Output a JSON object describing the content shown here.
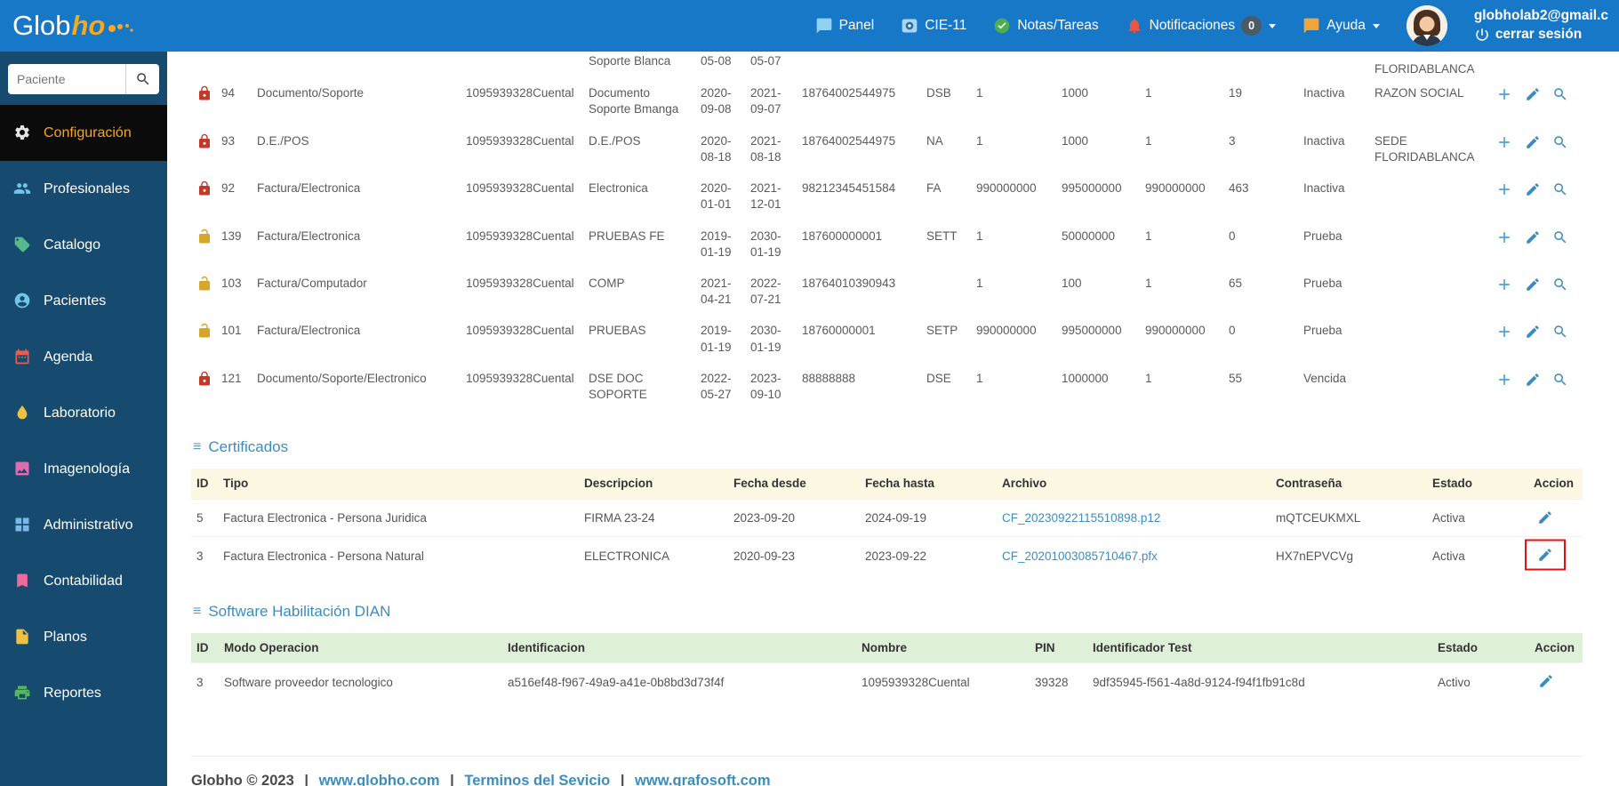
{
  "colors": {
    "navbar_blue": "#1878c8",
    "sidebar_navy": "#164a6e",
    "active_item_bg": "#0b0b0b",
    "active_item_text": "#f5a623",
    "link_blue": "#3c8dbc",
    "cert_header_bg": "#fcf8e3",
    "dian_header_bg": "#dff0d8",
    "annotation_red": "#e8100c",
    "lock_red": "#c0392b",
    "lock_gold": "#d4a72c"
  },
  "navbar": {
    "brand_glob": "Glob",
    "brand_ho": "ho",
    "items": [
      {
        "label": "Panel",
        "icon": "chat-icon"
      },
      {
        "label": "CIE-11",
        "icon": "cie11-icon"
      },
      {
        "label": "Notas/Tareas",
        "icon": "check-circle-icon"
      },
      {
        "label": "Notificaciones",
        "icon": "bell-icon",
        "badge": "0"
      },
      {
        "label": "Ayuda",
        "icon": "help-chat-icon"
      }
    ],
    "user_email": "globholab2@gmail.c",
    "logout_label": "cerrar sesión"
  },
  "sidebar": {
    "search_placeholder": "Paciente",
    "items": [
      {
        "label": "Configuración",
        "icon": "gear-icon",
        "active": true
      },
      {
        "label": "Profesionales",
        "icon": "people-icon"
      },
      {
        "label": "Catalogo",
        "icon": "tag-icon"
      },
      {
        "label": "Pacientes",
        "icon": "person-icon"
      },
      {
        "label": "Agenda",
        "icon": "calendar-icon"
      },
      {
        "label": "Laboratorio",
        "icon": "droplet-icon"
      },
      {
        "label": "Imagenología",
        "icon": "image-icon"
      },
      {
        "label": "Administrativo",
        "icon": "grid-icon"
      },
      {
        "label": "Contabilidad",
        "icon": "bookmark-icon"
      },
      {
        "label": "Planos",
        "icon": "file-icon"
      },
      {
        "label": "Reportes",
        "icon": "printer-icon"
      }
    ]
  },
  "resolutions": {
    "partial_row": {
      "desc": "Soporte Blanca",
      "fecha_desde": "05-08",
      "fecha_hasta": "05-07",
      "sede": "FLORIDABLANCA"
    },
    "rows": [
      {
        "lock": "closed-red",
        "id": "94",
        "tipo": "Documento/Soporte",
        "cuenta": "1095939328Cuental",
        "desc": "Documento Soporte Bmanga",
        "fd1": "2020-",
        "fd2": "09-08",
        "fh1": "2021-",
        "fh2": "09-07",
        "resolucion": "18764002544975",
        "prefijo": "DSB",
        "n1": "1",
        "n2": "1000",
        "n3": "1",
        "n4": "19",
        "estado": "Inactiva",
        "sede": "RAZON SOCIAL"
      },
      {
        "lock": "closed-red",
        "id": "93",
        "tipo": "D.E./POS",
        "cuenta": "1095939328Cuental",
        "desc": "D.E./POS",
        "fd1": "2020-",
        "fd2": "08-18",
        "fh1": "2021-",
        "fh2": "08-18",
        "resolucion": "18764002544975",
        "prefijo": "NA",
        "n1": "1",
        "n2": "1000",
        "n3": "1",
        "n4": "3",
        "estado": "Inactiva",
        "sede": "SEDE FLORIDABLANCA"
      },
      {
        "lock": "closed-red",
        "id": "92",
        "tipo": "Factura/Electronica",
        "cuenta": "1095939328Cuental",
        "desc": "Electronica",
        "fd1": "2020-",
        "fd2": "01-01",
        "fh1": "2021-",
        "fh2": "12-01",
        "resolucion": "98212345451584",
        "prefijo": "FA",
        "n1": "990000000",
        "n2": "995000000",
        "n3": "990000000",
        "n4": "463",
        "estado": "Inactiva",
        "sede": ""
      },
      {
        "lock": "open-gold",
        "id": "139",
        "tipo": "Factura/Electronica",
        "cuenta": "1095939328Cuental",
        "desc": "PRUEBAS FE",
        "fd1": "2019-",
        "fd2": "01-19",
        "fh1": "2030-",
        "fh2": "01-19",
        "resolucion": "187600000001",
        "prefijo": "SETT",
        "n1": "1",
        "n2": "50000000",
        "n3": "1",
        "n4": "0",
        "estado": "Prueba",
        "sede": ""
      },
      {
        "lock": "open-gold",
        "id": "103",
        "tipo": "Factura/Computador",
        "cuenta": "1095939328Cuental",
        "desc": "COMP",
        "fd1": "2021-",
        "fd2": "04-21",
        "fh1": "2022-",
        "fh2": "07-21",
        "resolucion": "18764010390943",
        "prefijo": "",
        "n1": "1",
        "n2": "100",
        "n3": "1",
        "n4": "65",
        "estado": "Prueba",
        "sede": ""
      },
      {
        "lock": "open-gold",
        "id": "101",
        "tipo": "Factura/Electronica",
        "cuenta": "1095939328Cuental",
        "desc": "PRUEBAS",
        "fd1": "2019-",
        "fd2": "01-19",
        "fh1": "2030-",
        "fh2": "01-19",
        "resolucion": "18760000001",
        "prefijo": "SETP",
        "n1": "990000000",
        "n2": "995000000",
        "n3": "990000000",
        "n4": "0",
        "estado": "Prueba",
        "sede": ""
      },
      {
        "lock": "closed-red",
        "id": "121",
        "tipo": "Documento/Soporte/Electronico",
        "cuenta": "1095939328Cuental",
        "desc": "DSE DOC SOPORTE",
        "fd1": "2022-",
        "fd2": "05-27",
        "fh1": "2023-",
        "fh2": "09-10",
        "resolucion": "88888888",
        "prefijo": "DSE",
        "n1": "1",
        "n2": "1000000",
        "n3": "1",
        "n4": "55",
        "estado": "Vencida",
        "sede": ""
      }
    ]
  },
  "certificados": {
    "title": "Certificados",
    "headers": [
      "ID",
      "Tipo",
      "Descripcion",
      "Fecha desde",
      "Fecha hasta",
      "Archivo",
      "Contraseña",
      "Estado",
      "Accion"
    ],
    "rows": [
      {
        "id": "5",
        "tipo": "Factura Electronica - Persona Juridica",
        "descripcion": "FIRMA 23-24",
        "fecha_desde": "2023-09-20",
        "fecha_hasta": "2024-09-19",
        "archivo": "CF_20230922115510898.p12",
        "contrasena": "mQTCEUKMXL",
        "estado": "Activa"
      },
      {
        "id": "3",
        "tipo": "Factura Electronica - Persona Natural",
        "descripcion": "ELECTRONICA",
        "fecha_desde": "2020-09-23",
        "fecha_hasta": "2023-09-22",
        "archivo": "CF_20201003085710467.pfx",
        "contrasena": "HX7nEPVCVg",
        "estado": "Activa",
        "annotated": true
      }
    ]
  },
  "dian": {
    "title": "Software Habilitación DIAN",
    "headers": [
      "ID",
      "Modo Operacion",
      "Identificacion",
      "Nombre",
      "PIN",
      "Identificador Test",
      "Estado",
      "Accion"
    ],
    "rows": [
      {
        "id": "3",
        "modo": "Software proveedor tecnologico",
        "identificacion": "a516ef48-f967-49a9-a41e-0b8bd3d73f4f",
        "nombre": "1095939328Cuental",
        "pin": "39328",
        "identificador_test": "9df35945-f561-4a8d-9124-f94f1fb91c8d",
        "estado": "Activo"
      }
    ]
  },
  "footer": {
    "copyright": "Globho © 2023",
    "separator": "|",
    "links": [
      "www.globho.com",
      "Terminos del Sevicio",
      "www.grafosoft.com"
    ]
  }
}
